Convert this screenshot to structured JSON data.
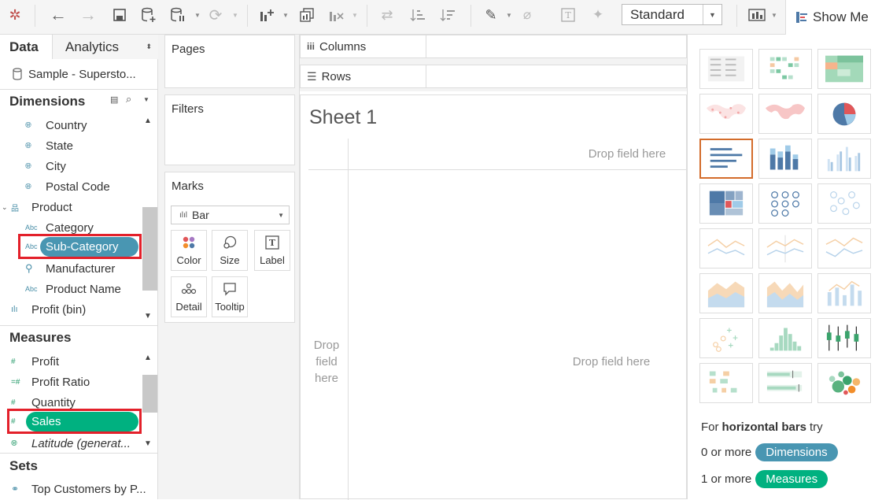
{
  "toolbar": {
    "view_select": "Standard",
    "show_me_label": "Show Me"
  },
  "left": {
    "tabs": {
      "data": "Data",
      "analytics": "Analytics"
    },
    "datasource": "Sample - Supersto...",
    "dimensions_header": "Dimensions",
    "dimensions": [
      {
        "icon": "globe-icon",
        "label": "Country"
      },
      {
        "icon": "globe-icon",
        "label": "State"
      },
      {
        "icon": "globe-icon",
        "label": "City"
      },
      {
        "icon": "globe-icon",
        "label": "Postal Code"
      },
      {
        "icon": "hierarchy-icon",
        "label": "Product"
      },
      {
        "icon": "abc-icon",
        "label": "Category",
        "glyph": "Abc"
      },
      {
        "icon": "abc-icon",
        "label": "Sub-Category",
        "glyph": "Abc"
      },
      {
        "icon": "paperclip-icon",
        "label": "Manufacturer"
      },
      {
        "icon": "abc-icon",
        "label": "Product Name",
        "glyph": "Abc"
      },
      {
        "icon": "bin-icon",
        "label": "Profit (bin)"
      }
    ],
    "measures_header": "Measures",
    "measures": [
      {
        "icon": "hash-icon",
        "label": "Profit"
      },
      {
        "icon": "calc-hash-icon",
        "label": "Profit Ratio"
      },
      {
        "icon": "hash-icon",
        "label": "Quantity"
      },
      {
        "icon": "hash-icon",
        "label": "Sales"
      },
      {
        "icon": "globe-icon",
        "label": "Latitude (generat..."
      }
    ],
    "sets_header": "Sets",
    "sets": [
      {
        "icon": "set-icon",
        "label": "Top Customers by P..."
      }
    ]
  },
  "cards": {
    "pages": "Pages",
    "filters": "Filters",
    "marks": "Marks",
    "mark_type": "Bar",
    "mark_buttons": [
      "Color",
      "Size",
      "Label",
      "Detail",
      "Tooltip"
    ]
  },
  "shelves": {
    "columns": "Columns",
    "rows": "Rows"
  },
  "sheet": {
    "title": "Sheet 1",
    "drop_top": "Drop field here",
    "drop_center": "Drop field here",
    "drop_left": "Drop field here"
  },
  "showme": {
    "hint_prefix": "For",
    "hint_bold": "horizontal bars",
    "hint_suffix": "try",
    "dim_count": "0 or more",
    "dim_chip": "Dimensions",
    "meas_count": "1 or more",
    "meas_chip": "Measures"
  },
  "colors": {
    "dimension_pill": "#4996b2",
    "measure_pill": "#00b180",
    "highlight": "#e3202a",
    "selected_chart": "#d36c2b"
  }
}
